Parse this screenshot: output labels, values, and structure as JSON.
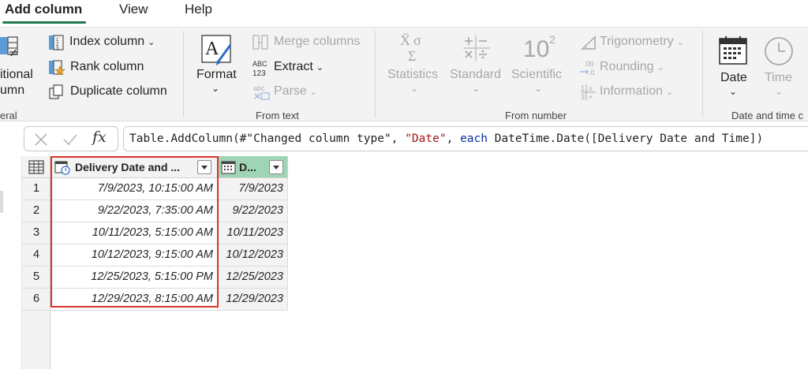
{
  "tabs": [
    {
      "label": "Add column",
      "active": true
    },
    {
      "label": "View",
      "active": false
    },
    {
      "label": "Help",
      "active": false
    }
  ],
  "ribbon": {
    "general": {
      "conditional_label_line1": "itional",
      "conditional_label_line2": "umn",
      "index_column": "Index column",
      "rank_column": "Rank column",
      "duplicate_column": "Duplicate column",
      "group_label": "eral"
    },
    "from_text": {
      "format": "Format",
      "merge_columns": "Merge columns",
      "extract": "Extract",
      "parse": "Parse",
      "group_label": "From text"
    },
    "from_number": {
      "statistics": "Statistics",
      "standard": "Standard",
      "scientific": "Scientific",
      "trigonometry": "Trigonometry",
      "rounding": "Rounding",
      "information": "Information",
      "group_label": "From number"
    },
    "date_time": {
      "date": "Date",
      "time": "Time",
      "group_label": "Date and time c"
    }
  },
  "formula_bar": {
    "fx": "fx",
    "parts": {
      "p1": "Table.AddColumn(#\"Changed column type\", ",
      "p2": "\"Date\"",
      "p3": ", ",
      "p4": "each",
      "p5": " DateTime.Date([Delivery Date and Time])"
    }
  },
  "grid": {
    "columns": [
      {
        "label": "Delivery Date and ...",
        "type_icon": "datetime-type-icon"
      },
      {
        "label": "D...",
        "type_icon": "date-type-icon"
      }
    ],
    "rows": [
      {
        "num": "1",
        "c1": "7/9/2023, 10:15:00 AM",
        "c2": "7/9/2023"
      },
      {
        "num": "2",
        "c1": "9/22/2023, 7:35:00 AM",
        "c2": "9/22/2023"
      },
      {
        "num": "3",
        "c1": "10/11/2023, 5:15:00 AM",
        "c2": "10/11/2023"
      },
      {
        "num": "4",
        "c1": "10/12/2023, 9:15:00 AM",
        "c2": "10/12/2023"
      },
      {
        "num": "5",
        "c1": "12/25/2023, 5:15:00 PM",
        "c2": "12/25/2023"
      },
      {
        "num": "6",
        "c1": "12/29/2023, 8:15:00 AM",
        "c2": "12/29/2023"
      }
    ]
  },
  "colors": {
    "accent_green": "#1f7a4c",
    "selected_column_bg": "#9fd5b6",
    "highlight_red": "#d9322b",
    "formula_string": "#a31515",
    "formula_keyword": "#0a2f9e"
  }
}
